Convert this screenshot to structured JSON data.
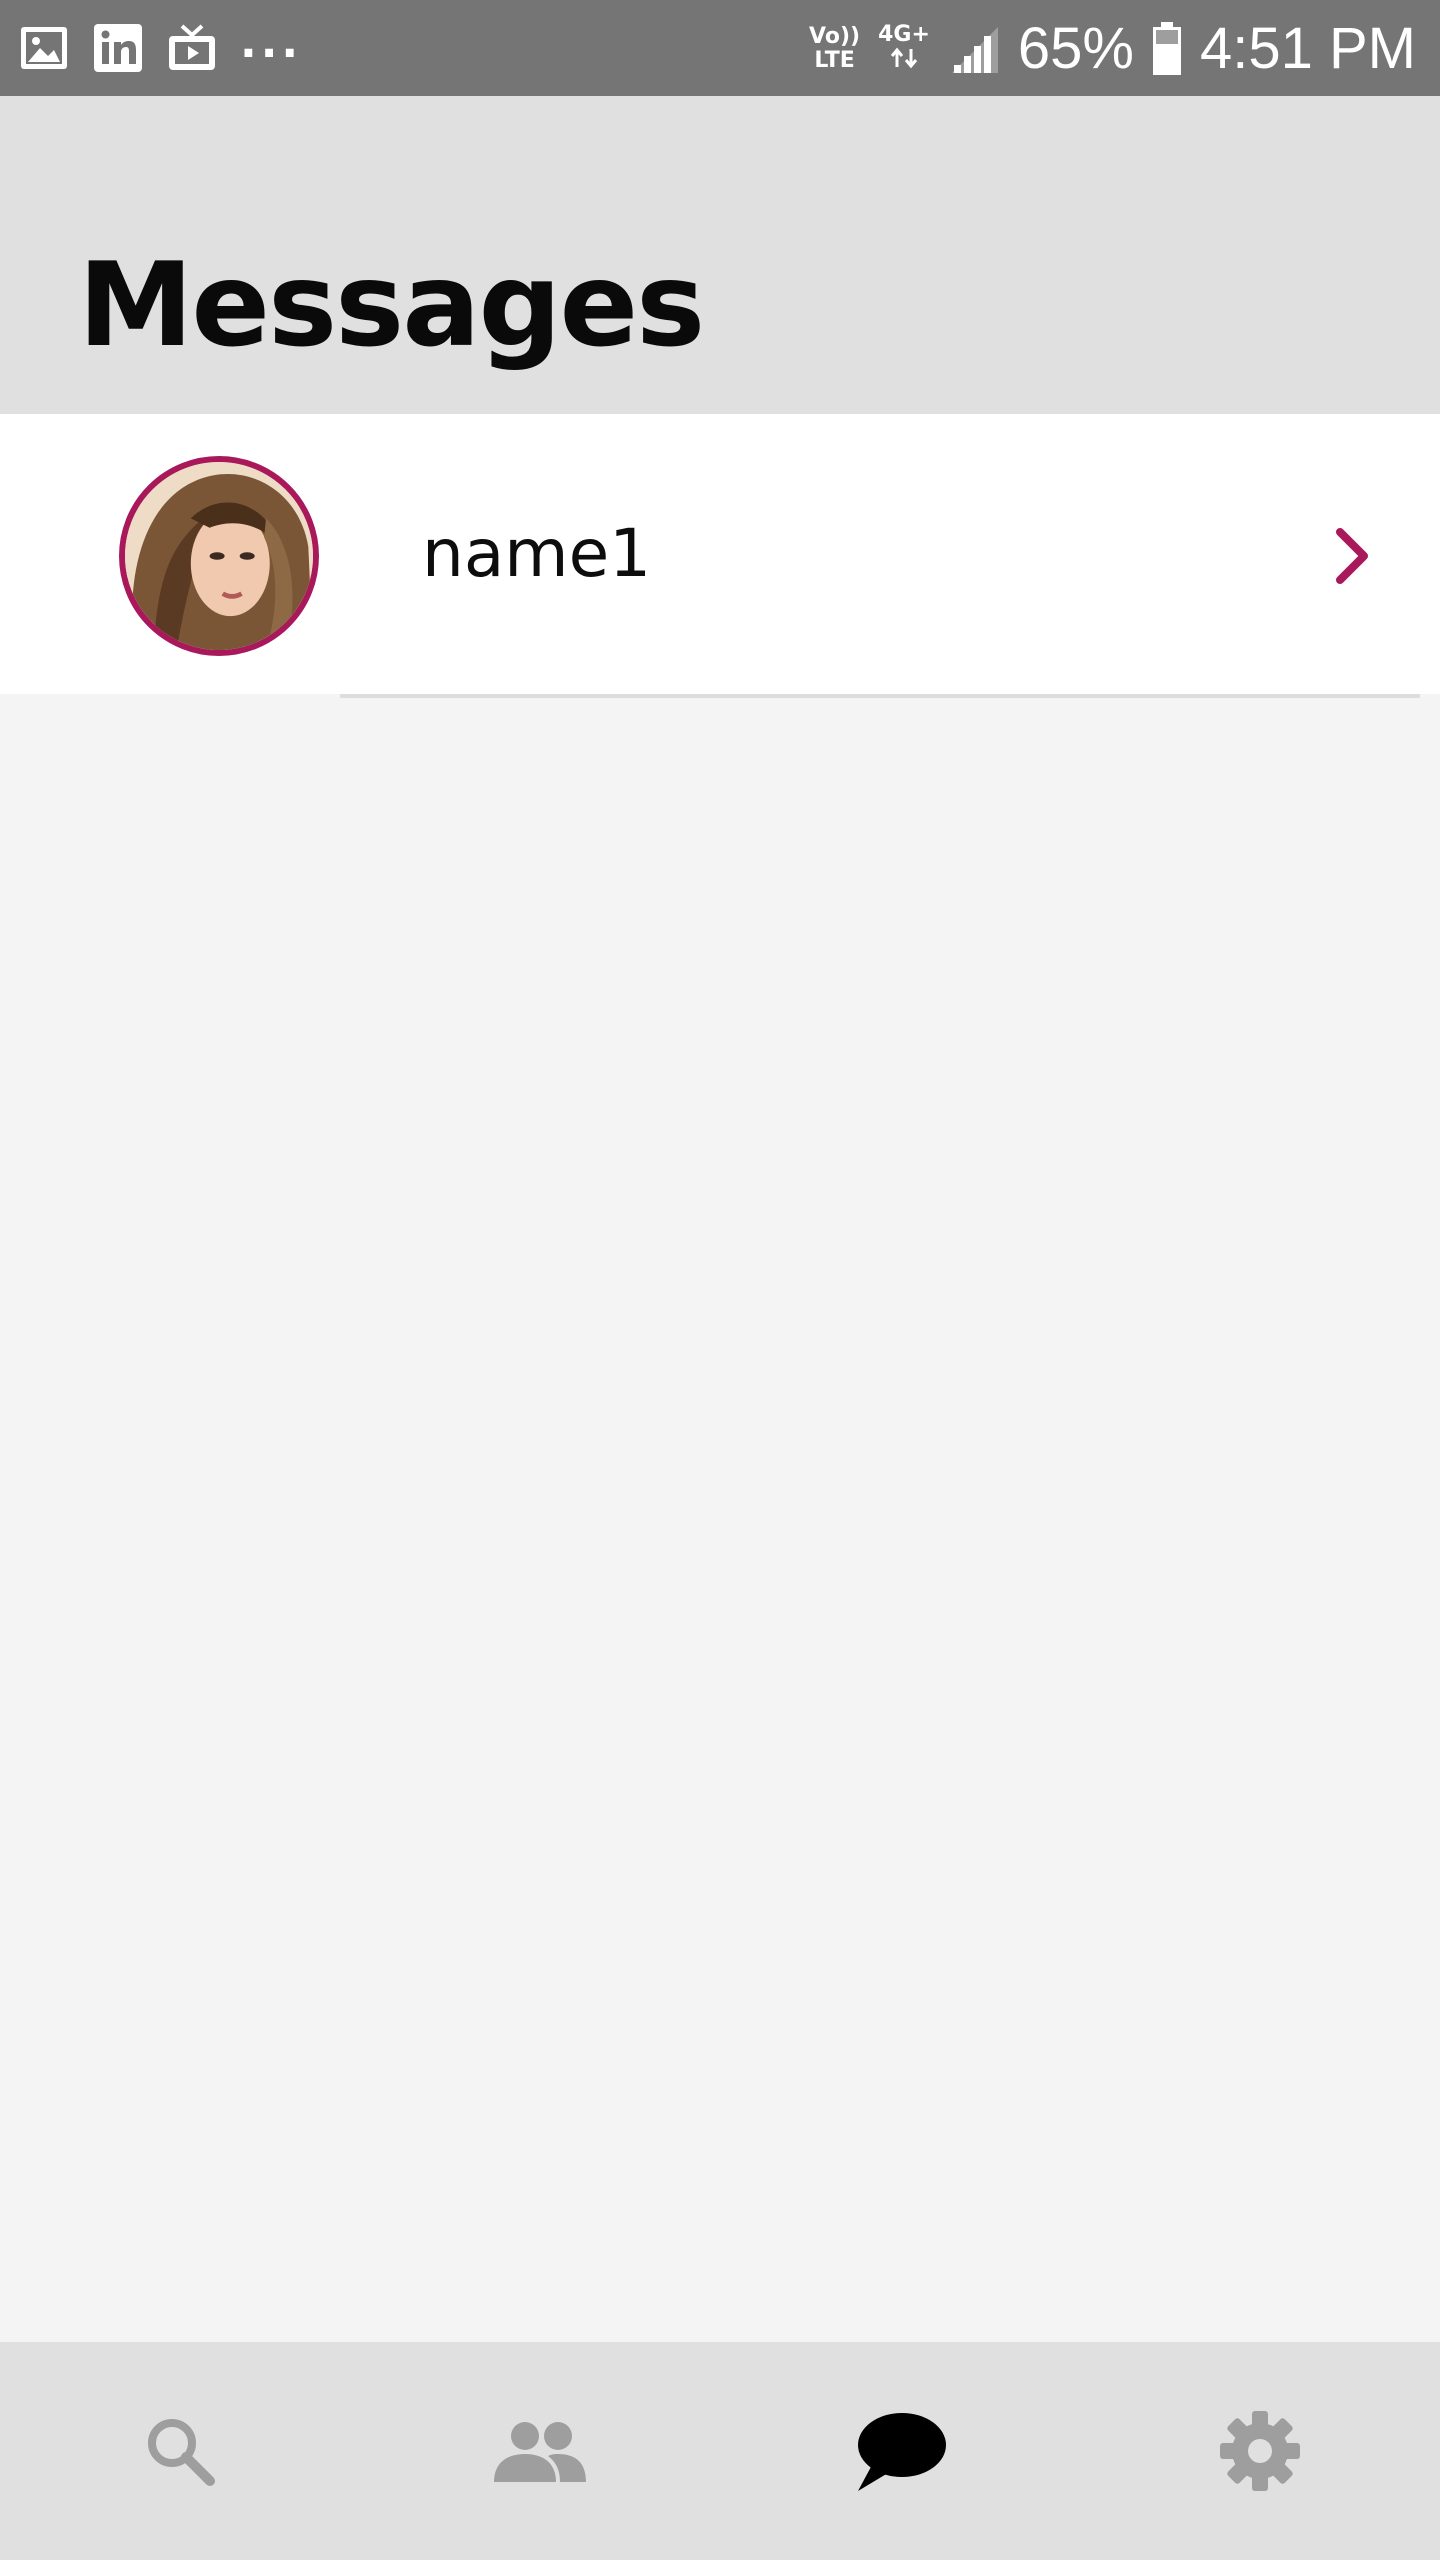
{
  "status_bar": {
    "notification_icons": [
      "image-icon",
      "linkedin-icon",
      "tv-icon"
    ],
    "overflow": "...",
    "volte_top": "Vo))",
    "volte_bottom": "LTE",
    "network": "4G+",
    "battery_percent": "65%",
    "time": "4:51 PM"
  },
  "header": {
    "title": "Messages"
  },
  "messages": [
    {
      "name": "name1",
      "avatar": "avatar-photo"
    }
  ],
  "bottom_nav": {
    "items": [
      {
        "icon": "search-icon",
        "active": false
      },
      {
        "icon": "people-icon",
        "active": false
      },
      {
        "icon": "chat-bubble-icon",
        "active": true
      },
      {
        "icon": "gear-icon",
        "active": false
      }
    ]
  },
  "colors": {
    "accent": "#a8185a",
    "status_bar_bg": "#757575",
    "header_bg": "#e0e0e0",
    "content_bg": "#f4f4f4",
    "nav_inactive": "#9e9e9e",
    "nav_active": "#000000"
  }
}
